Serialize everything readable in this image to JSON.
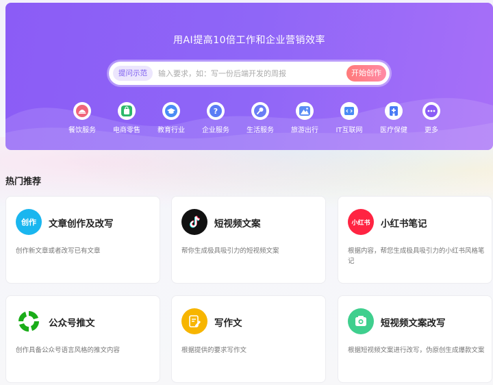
{
  "hero": {
    "title": "用AI提高10倍工作和企业营销效率",
    "search": {
      "tag": "提问示范",
      "placeholder": "输入要求，如：写一份后端开发的周报",
      "button": "开始创作"
    },
    "categories": [
      {
        "label": "餐饮服务",
        "icon": "dining-icon",
        "color": "#f0657a"
      },
      {
        "label": "电商零售",
        "icon": "shopping-bag-icon",
        "color": "#2db86b"
      },
      {
        "label": "教育行业",
        "icon": "graduation-cap-icon",
        "color": "#4a8bf5"
      },
      {
        "label": "企业服务",
        "icon": "question-icon",
        "color": "#5b7cf5"
      },
      {
        "label": "生活服务",
        "icon": "microphone-icon",
        "color": "#6a7df5"
      },
      {
        "label": "旅游出行",
        "icon": "mountain-icon",
        "color": "#5b8df5"
      },
      {
        "label": "IT互联网",
        "icon": "code-icon",
        "color": "#4a8bf5"
      },
      {
        "label": "医疗保健",
        "icon": "hospital-icon",
        "color": "#4a7bf5"
      },
      {
        "label": "更多",
        "icon": "more-icon",
        "color": "#8b5cf6"
      }
    ]
  },
  "section": {
    "title": "热门推荐"
  },
  "cards": [
    {
      "title": "文章创作及改写",
      "desc": "创作新文章或者改写已有文章",
      "icon": "article-icon",
      "icon_text": "创作",
      "color": "#1ab6ef"
    },
    {
      "title": "短视频文案",
      "desc": "帮你生成极具吸引力的短视频文案",
      "icon": "tiktok-icon",
      "color": "#111111"
    },
    {
      "title": "小红书笔记",
      "desc": "根据内容，帮您生成极具吸引力的小红书风格笔记",
      "icon": "xiaohongshu-icon",
      "icon_text": "小红书",
      "color": "#ff2442"
    },
    {
      "title": "公众号推文",
      "desc": "创作具备公众号语言风格的推文内容",
      "icon": "wechat-official-icon",
      "color": "#1aad19"
    },
    {
      "title": "写作文",
      "desc": "根据提供的要求写作文",
      "icon": "essay-icon",
      "color": "#f7b500"
    },
    {
      "title": "短视频文案改写",
      "desc": "根据短视频文案进行改写，伪原创生成爆款文案",
      "icon": "video-rewrite-icon",
      "color": "#3fcf8e"
    }
  ]
}
